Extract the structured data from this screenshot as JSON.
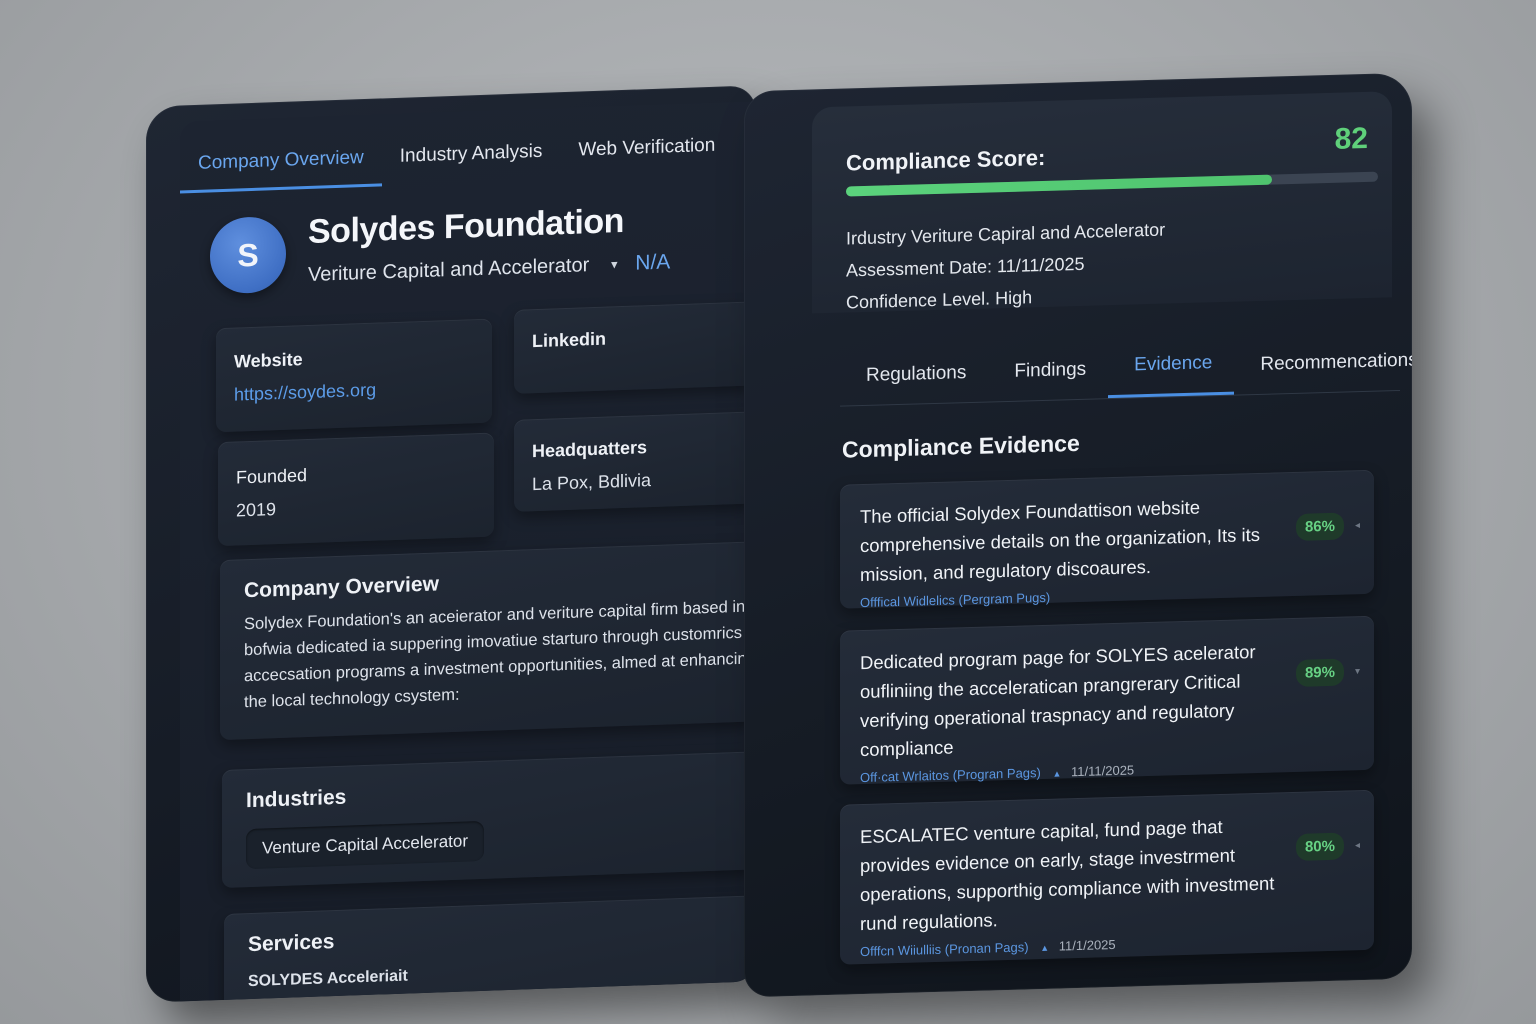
{
  "left": {
    "tabs": [
      {
        "label": "Company Overview",
        "active": true
      },
      {
        "label": "Industry Analysis",
        "active": false
      },
      {
        "label": "Web Verification",
        "active": false
      }
    ],
    "profile": {
      "avatar_letter": "S",
      "name": "Solydes Foundation",
      "subtitle": "Veriture Capital and Accelerator",
      "status": "N/A"
    },
    "website": {
      "label": "Website",
      "value": "https://soydes.org"
    },
    "linkedin": {
      "label": "Linkedin"
    },
    "founded": {
      "label": "Founded",
      "value": "2019"
    },
    "headquarters": {
      "label": "Headquatters",
      "value": "La Pox, Bdlivia"
    },
    "overview": {
      "title": "Company Overview",
      "text": "Solydex Foundation's an aceierator and veriture capital firm based in bofwia dedicated ia suppering imovatiue starturo through customrics accecsation programs a investment opportunities, almed at enhancing the local technology csystem:"
    },
    "industries": {
      "title": "Industries",
      "chip": "Venture Capital Accelerator"
    },
    "services": {
      "title": "Services",
      "value": "SOLYDES Acceleriait"
    }
  },
  "right": {
    "score": {
      "label": "Compliance Score:",
      "value": "82",
      "fraction": 0.8
    },
    "meta": {
      "industry": "Irdustry Veriture Capiral and Accelerator",
      "assessment": "Assessment Date: 11/11/2025",
      "confidence": "Confidence Level. High"
    },
    "tabs": [
      {
        "label": "Regulations",
        "active": false
      },
      {
        "label": "Findings",
        "active": false
      },
      {
        "label": "Evidence",
        "active": true
      },
      {
        "label": "Recommencations",
        "active": false
      }
    ],
    "evidence_title": "Compliance Evidence",
    "evidence": [
      {
        "text": "The official Solydex Foundattison website comprehensive details on the organization, Its its mission, and regulatory discoaures.",
        "source": "Offfical Widlelics (Pergram Pugs)",
        "date": "",
        "badge": "86%"
      },
      {
        "text": "Dedicated program page for SOLYES acelerator oufliniing the acceleratican prangrerary Critical verifying operational traspnacy and regulatory compliance",
        "source": "Off·cat Wrlaitos (Progran Pags)",
        "date": "11/11/2025",
        "badge": "89%"
      },
      {
        "text": "ESCALATEC venture capital, fund page that provides evidence on early, stage investrment operations, supporthig compliance with investment rund regulations.",
        "source": "Offfcn Wiiulliis (Pronan Pags)",
        "date": "11/1/2025",
        "badge": "80%"
      }
    ]
  }
}
